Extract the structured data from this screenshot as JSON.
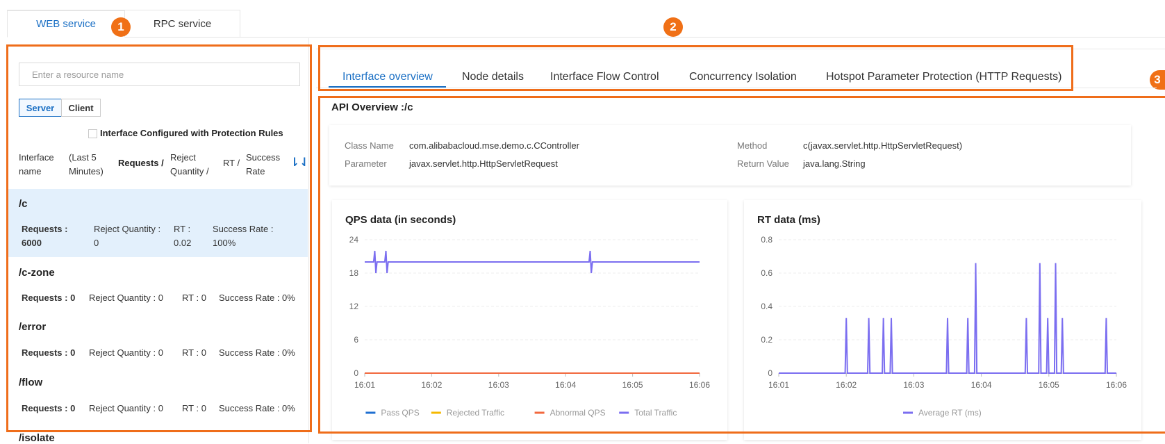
{
  "top_tabs": [
    {
      "label": "WEB service",
      "active": true
    },
    {
      "label": "RPC service",
      "active": false
    }
  ],
  "badges": [
    "1",
    "2",
    "3"
  ],
  "left": {
    "search_placeholder": "Enter a resource name",
    "seg_server": "Server",
    "seg_client": "Client",
    "filter_label": "Interface Configured with Protection Rules",
    "headers": {
      "name": "Interface name",
      "period": "(Last 5 Minutes)",
      "requests": "Requests /",
      "reject": "Reject Quantity /",
      "rt": "RT /",
      "success": "Success Rate"
    },
    "items": [
      {
        "name": "/c",
        "requests_label": "Requests :",
        "requests": "6000",
        "reject_label": "Reject Quantity :",
        "reject": "0",
        "rt_label": "RT :",
        "rt": "0.02",
        "success_label": "Success Rate :",
        "success": "100%"
      },
      {
        "name": "/c-zone",
        "requests": "Requests : 0",
        "reject": "Reject Quantity : 0",
        "rt": "RT : 0",
        "success": "Success Rate : 0%"
      },
      {
        "name": "/error",
        "requests": "Requests : 0",
        "reject": "Reject Quantity : 0",
        "rt": "RT : 0",
        "success": "Success Rate : 0%"
      },
      {
        "name": "/flow",
        "requests": "Requests : 0",
        "reject": "Reject Quantity : 0",
        "rt": "RT : 0",
        "success": "Success Rate : 0%"
      },
      {
        "name": "/isolate"
      }
    ]
  },
  "subtabs": [
    {
      "label": "Interface overview",
      "active": true
    },
    {
      "label": "Node details",
      "active": false
    },
    {
      "label": "Interface Flow Control",
      "active": false
    },
    {
      "label": "Concurrency Isolation",
      "active": false
    },
    {
      "label": "Hotspot Parameter Protection (HTTP Requests)",
      "active": false
    }
  ],
  "overview": {
    "title": "API Overview :/c",
    "class_name_label": "Class Name",
    "class_name": "com.alibabacloud.mse.demo.c.CController",
    "parameter_label": "Parameter",
    "parameter": "javax.servlet.http.HttpServletRequest",
    "method_label": "Method",
    "method": "c(javax.servlet.http.HttpServletRequest)",
    "return_label": "Return Value",
    "return_value": "java.lang.String"
  },
  "colors": {
    "accent": "#1a6fc4",
    "highlight": "#ef6d1a",
    "pass_qps": "#1f6fd1",
    "rejected": "#f5b800",
    "abnormal": "#f2683e",
    "total": "#7b6ef0"
  },
  "chart_data": [
    {
      "type": "line",
      "title": "QPS data (in seconds)",
      "x_ticks": [
        "16:01",
        "16:02",
        "16:03",
        "16:04",
        "16:05",
        "16:06"
      ],
      "y_ticks": [
        "0",
        "6",
        "12",
        "18",
        "24"
      ],
      "ylim": [
        0,
        24
      ],
      "xlim": [
        "16:01",
        "16:06"
      ],
      "grid": true,
      "legend": "bottom",
      "series": [
        {
          "name": "Pass QPS",
          "color": "#1f6fd1",
          "points": [
            [
              "16:01",
              0
            ],
            [
              "16:06",
              0
            ]
          ]
        },
        {
          "name": "Rejected Traffic",
          "color": "#f5b800",
          "points": [
            [
              "16:01",
              0
            ],
            [
              "16:06",
              0
            ]
          ]
        },
        {
          "name": "Abnormal QPS",
          "color": "#f2683e",
          "points": [
            [
              "16:01",
              0
            ],
            [
              "16:06",
              0
            ]
          ]
        },
        {
          "name": "Total Traffic",
          "color": "#7b6ef0",
          "points": [
            [
              "16:01:00",
              20
            ],
            [
              "16:01:08",
              20
            ],
            [
              "16:01:09",
              22
            ],
            [
              "16:01:10",
              18
            ],
            [
              "16:01:11",
              20
            ],
            [
              "16:01:18",
              20
            ],
            [
              "16:01:19",
              22
            ],
            [
              "16:01:20",
              18
            ],
            [
              "16:01:21",
              20
            ],
            [
              "16:04:21",
              20
            ],
            [
              "16:04:22",
              22
            ],
            [
              "16:04:23",
              18
            ],
            [
              "16:04:24",
              20
            ],
            [
              "16:06:00",
              20
            ]
          ]
        }
      ]
    },
    {
      "type": "line",
      "title": "RT data (ms)",
      "x_ticks": [
        "16:01",
        "16:02",
        "16:03",
        "16:04",
        "16:05",
        "16:06"
      ],
      "y_ticks": [
        "0",
        "0.2",
        "0.4",
        "0.6",
        "0.8"
      ],
      "ylim": [
        0,
        0.8
      ],
      "xlim": [
        "16:01",
        "16:06"
      ],
      "grid": true,
      "legend": "bottom",
      "series": [
        {
          "name": "Average RT (ms)",
          "color": "#7b6ef0",
          "spikes": [
            [
              "16:02:00",
              0.33
            ],
            [
              "16:02:20",
              0.33
            ],
            [
              "16:02:33",
              0.33
            ],
            [
              "16:02:40",
              0.33
            ],
            [
              "16:03:30",
              0.33
            ],
            [
              "16:03:48",
              0.33
            ],
            [
              "16:03:55",
              0.66
            ],
            [
              "16:04:40",
              0.33
            ],
            [
              "16:04:52",
              0.66
            ],
            [
              "16:04:59",
              0.33
            ],
            [
              "16:05:06",
              0.66
            ],
            [
              "16:05:12",
              0.33
            ],
            [
              "16:05:51",
              0.33
            ]
          ]
        }
      ]
    }
  ]
}
